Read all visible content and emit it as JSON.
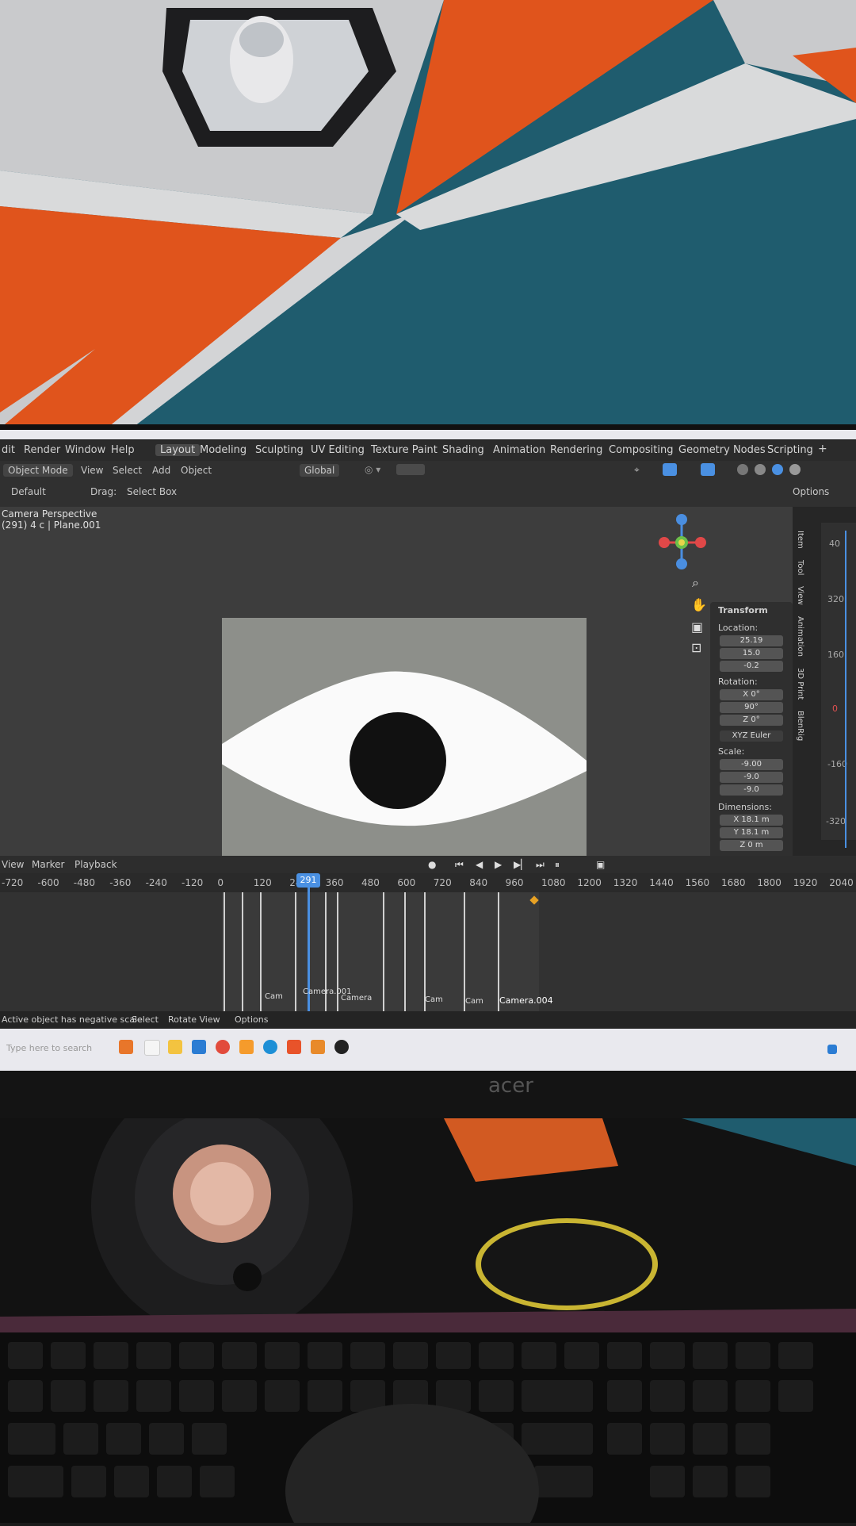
{
  "menu": [
    "dit",
    "Render",
    "Window",
    "Help"
  ],
  "workspaces": [
    "Layout",
    "Modeling",
    "Sculpting",
    "UV Editing",
    "Texture Paint",
    "Shading",
    "Animation",
    "Rendering",
    "Compositing",
    "Geometry Nodes",
    "Scripting"
  ],
  "header": {
    "mode": "Object Mode",
    "menus": [
      "View",
      "Select",
      "Add",
      "Object"
    ],
    "orientation": "Global",
    "preset": "Default",
    "drag": "Drag:",
    "select_box": "Select Box",
    "options": "Options"
  },
  "viewport": {
    "line1": "Camera Perspective",
    "line2": "(291) 4 c | Plane.001"
  },
  "npanel": {
    "section": "Transform",
    "location_label": "Location:",
    "location": [
      "25.19",
      "15.0",
      "-0.2"
    ],
    "rotation_label": "Rotation:",
    "rotation": [
      "X  0°",
      "90°",
      "Z  0°"
    ],
    "rotation_mode": "XYZ Euler",
    "scale_label": "Scale:",
    "scale": [
      "-9.00",
      "-9.0",
      "-9.0"
    ],
    "dimensions_label": "Dimensions:",
    "dimensions": [
      "X  18.1 m",
      "Y  18.1 m",
      "Z  0 m"
    ]
  },
  "sidetabs": [
    "Item",
    "Tool",
    "View",
    "Animation",
    "3D Print",
    "BlenRig"
  ],
  "right_ruler": [
    "40",
    "320",
    "160",
    "0",
    "-160",
    "-320"
  ],
  "timeline": {
    "menus": [
      "View",
      "Marker",
      "Playback"
    ],
    "current_frame": "291",
    "ticks": [
      "-720",
      "-600",
      "-480",
      "-360",
      "-240",
      "-120",
      "0",
      "120",
      "240",
      "360",
      "480",
      "600",
      "720",
      "840",
      "960",
      "1080",
      "1200",
      "1320",
      "1440",
      "1560",
      "1680",
      "1800",
      "1920",
      "2040"
    ],
    "marker_labels": [
      "Cam",
      "Camera.001",
      "Camera",
      "Cam",
      "Cam",
      "Camera.004"
    ]
  },
  "status": {
    "warning": "Active object has negative scale",
    "select": "Select",
    "rotate": "Rotate View",
    "options": "Options"
  },
  "taskbar": {
    "search_placeholder": "Type here to search"
  },
  "monitor_brand": "acer",
  "colors": {
    "blender_bg": "#3d3d3d",
    "accent_blue": "#4a90e2",
    "wall_orange": "#e0541c",
    "wall_teal": "#1f5c6e",
    "wall_grey": "#c9cacc"
  }
}
